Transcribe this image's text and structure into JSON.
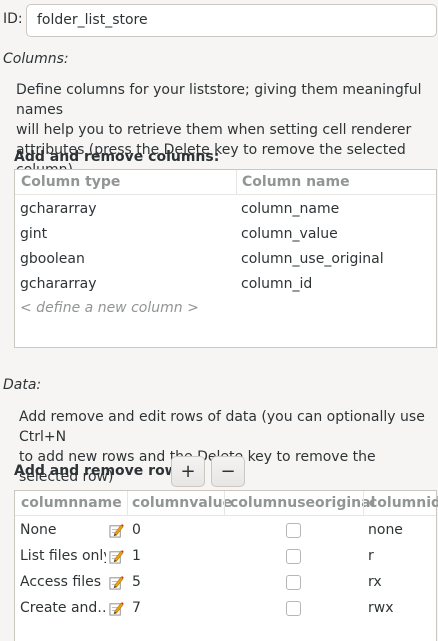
{
  "id_field": {
    "label": "ID:",
    "value": "folder_list_store"
  },
  "columns_section": {
    "title": "Columns:",
    "description_line1": "Define columns for your liststore; giving them meaningful names",
    "description_line2": "will help you to retrieve them when setting cell renderer",
    "description_line3": "attributes (press the Delete key to remove the selected column)",
    "heading": "Add and remove columns:",
    "headers": {
      "type": "Column type",
      "name": "Column name"
    },
    "rows": [
      {
        "type": "gchararray",
        "name": "column_name"
      },
      {
        "type": "gint",
        "name": "column_value"
      },
      {
        "type": "gboolean",
        "name": "column_use_original"
      },
      {
        "type": "gchararray",
        "name": "column_id"
      }
    ],
    "new_column_placeholder": "< define a new column >"
  },
  "data_section": {
    "title": "Data:",
    "description_line1": "Add remove and edit rows of data (you can optionally use Ctrl+N",
    "description_line2": "to add new rows and the Delete key to remove the selected row)",
    "heading": "Add and remove rows:",
    "add_label": "+",
    "remove_label": "−",
    "headers": {
      "c1": "columnname",
      "c2": "columnvalue",
      "c3": "columnuseoriginal",
      "c4": "columnid"
    },
    "rows": [
      {
        "name": "None",
        "value": "0",
        "use_original": false,
        "id": "none"
      },
      {
        "name": "List files only",
        "value": "1",
        "use_original": false,
        "id": "r"
      },
      {
        "name": "Access files",
        "value": "5",
        "use_original": false,
        "id": "rx"
      },
      {
        "name": "Create and…",
        "value": "7",
        "use_original": false,
        "id": "rwx"
      }
    ]
  },
  "icons": {
    "edit": "pencil-edit-icon"
  }
}
